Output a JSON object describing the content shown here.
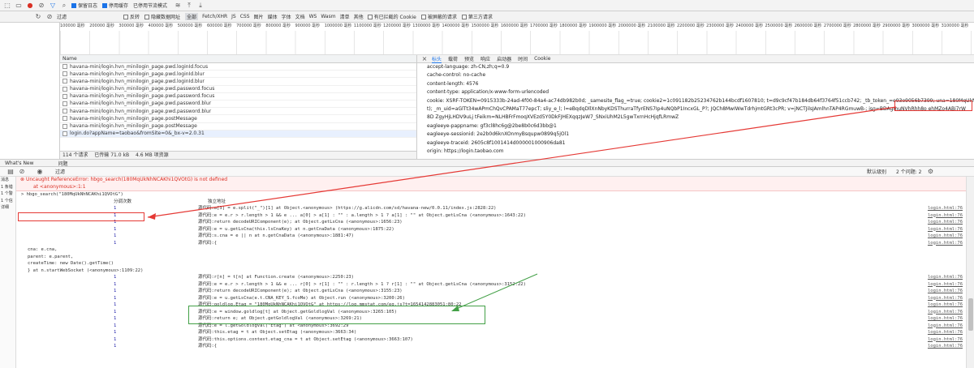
{
  "toolbar1": {
    "preserve_log": "保留日志",
    "disable_cache": "停用缓存",
    "throttle": "已停用节流模式"
  },
  "toolbar2": {
    "filter_label": "过滤",
    "invert": "反转",
    "hide_data_urls": "隐藏数据网址",
    "filters": [
      "全部",
      "Fetch/XHR",
      "JS",
      "CSS",
      "图片",
      "媒体",
      "字体",
      "文档",
      "WS",
      "Wasm",
      "清单",
      "其他"
    ],
    "blocked_cookies": "有已拦截的 Cookie",
    "blocked_requests": "被屏蔽的请求",
    "third_party": "第三方请求"
  },
  "timeline": [
    "100000 毫秒",
    "200000 毫秒",
    "300000 毫秒",
    "400000 毫秒",
    "500000 毫秒",
    "600000 毫秒",
    "700000 毫秒",
    "800000 毫秒",
    "900000 毫秒",
    "1000000 毫秒",
    "1100000 毫秒",
    "1200000 毫秒",
    "1300000 毫秒",
    "1400000 毫秒",
    "1500000 毫秒",
    "1600000 毫秒",
    "1700000 毫秒",
    "1800000 毫秒",
    "1900000 毫秒",
    "2000000 毫秒",
    "2100000 毫秒",
    "2200000 毫秒",
    "2300000 毫秒",
    "2400000 毫秒",
    "2500000 毫秒",
    "2600000 毫秒",
    "2700000 毫秒",
    "2800000 毫秒",
    "2900000 毫秒",
    "3000000 毫秒",
    "3100000 毫秒"
  ],
  "netlist": {
    "header": "Name",
    "rows": [
      "havana-mini/login.hvn_minilogin_page.pwd.loginId.focus",
      "havana-mini/login.hvn_minilogin_page.pwd.loginId.blur",
      "havana-mini/login.hvn_minilogin_page.pwd.loginId.blur",
      "havana-mini/login.hvn_minilogin_page.pwd.password.focus",
      "havana-mini/login.hvn_minilogin_page.pwd.password.focus",
      "havana-mini/login.hvn_minilogin_page.pwd.password.blur",
      "havana-mini/login.hvn_minilogin_page.pwd.password.blur",
      "havana-mini/login.hvn_minilogin_page.postMessage",
      "havana-mini/login.hvn_minilogin_page.postMessage",
      "login.do?appName=taobao&fromSite=0&_bx-v=2.0.31"
    ],
    "status": [
      "114 个请求",
      "已传输 71.0 kB",
      "4.6 MB 项资源"
    ]
  },
  "details": {
    "tabs": [
      "标头",
      "载荷",
      "预览",
      "响应",
      "启动器",
      "时间",
      "Cookie"
    ],
    "headers": [
      "accept-language: zh-CN,zh;q=0.9",
      "cache-control: no-cache",
      "content-length: 4576",
      "content-type: application/x-www-form-urlencoded",
      "cookie: XSRF-TOKEN=0915333b-24ad-4f00-84a4-ac74db982b0d; _samesite_flag_=true; cookie2=1c091182b25234762b144bcdf1607810; t=d9c9cf47b184db64f3764f51ccb742; _tb_token_=e93e9056b7399; una=180MqUkNhNCAKhi1QVOtG",
      "t); _m_uid=aGlTt34wAPmChQvCPAMaT77epcT; sliy_e_l; l=eBqdqDllXnNbyKDSThurraTfyrENS7Ip4uNQbP1IncxGL_P?; JQCh8MwIWwTdrhjmtGRt3cPR; v=jNCTJilsJAmlhnTAP4RGmuwB-; isg=BDAgmuNVhRhh8o ehMZo4ABi7rW",
      "8D ZgyHjLHDV9uLj tFeikm=NLHBFrFmoqXVEzd5Y0DkFJHEXqqzJeW7_SNxiUhM2L5gwTxrnHcHjqfLRmwZ",
      "eagleeye-pappname: gf3cl8hc6g@2be8b0c6d3bb@1",
      "eagleeye-sessionid: 2e2b0d6knXOnmyBsqupw0899q5jOl1",
      "eagleeye-traceid: 2605c8f1001414d000001000906da81",
      "origin: https://login.taobao.com"
    ]
  },
  "drawer": {
    "tabs": [
      "What's New",
      "问题"
    ]
  },
  "console_toolbar": {
    "filter": "过滤",
    "levels": "默认级别",
    "issues": "2 个问题: 2"
  },
  "sidebar": [
    "消息",
    "1 条错误",
    "1 个警告",
    "1 个信息",
    "详细"
  ],
  "console": {
    "error_line1": "Uncaught ReferenceError: hbgo_search(180MqUkNhNCAKhi1QVOtG) is not defined",
    "error_line2": "at <anonymous>:1:1",
    "input_line": "> hbgo_search(\"180MqUkNhNCAKhi1QVOtG\")",
    "col_count": "分调次数",
    "col_trace": "独立地址",
    "rows": [
      {
        "num": "1",
        "txt": "源代码:a[3] = e.split(\"_\")[1]   at Object.<anonymous> (https://g.alicdn.com/sd/havana-new/0.0.11/index.js:2828:22)",
        "src": "login.html:76"
      },
      {
        "num": "1",
        "txt": "源代码:e = e.r > r.length > 1 && e ... a[0] > a[1] : \"\" : a.length > 1 ? a[1] : \"\"   at Object.getLsCna (<anonymous>:1643:22)",
        "src": "login.html:76"
      },
      {
        "num": "1",
        "txt": "源代码:return decodeURIComponent(e);   at Object.getLsCna (<anonymous>:1656:23)",
        "src": "login.html:76"
      },
      {
        "num": "1",
        "txt": "源代码:e = u.getLsCna(this.lsCnaKey)   at n.getCnaData (<anonymous>:1875:22)",
        "src": "login.html:76"
      },
      {
        "num": "1",
        "txt": "源代码:s.cna = e || n   at n.getCnaData (<anonymous>:1881:47)",
        "src": "login.html:76"
      },
      {
        "num": "1",
        "txt": "源代码:{",
        "src": "login.html:76"
      },
      {
        "plain": "cna: e.cna,"
      },
      {
        "plain": "parent: e.parent,"
      },
      {
        "plain": "createTime: new Date().getTime()"
      },
      {
        "plain": "}     at n.startWebSocket (<anonymous>:1109:22)"
      },
      {
        "num": "1",
        "txt": "源代码:r[n] = t[n]   at Function.create (<anonymous>:2250:23)",
        "src": "login.html:76"
      },
      {
        "num": "1",
        "txt": "源代码:e = e.r > r.length > 1 && e ... r[0] > r[1] : \"\" : r.length > 1 ? r[1] : \"\"   at Object.getLsCna (<anonymous>:3152:22)",
        "src": "login.html:76"
      },
      {
        "num": "1",
        "txt": "源代码:return decodeURIComponent(e);   at Object.getLsCna (<anonymous>:3155:23)",
        "src": "login.html:76"
      },
      {
        "num": "1",
        "txt": "源代码:e = u.getLsCna(e.t.CNA_KEY_S.fcoMe)   at Object.run (<anonymous>:3200:26)",
        "src": "login.html:76"
      },
      {
        "num": "1",
        "txt": "源代码:goldlog.Etag = \"180MqUkNhNCAKhi1QVOtG\"   at https://log.mmstat.com/eg.js?t=1654142883051:80:22",
        "src": "login.html:76"
      },
      {
        "num": "1",
        "txt": "源代码:e = window.goldlog[t]   at Object.getGoldlogVal (<anonymous>:3265:105)",
        "src": "login.html:76"
      },
      {
        "num": "1",
        "txt": "源代码:return e;   at Object.getGoldlogVal (<anonymous>:3269:21)",
        "src": "login.html:76"
      },
      {
        "num": "1",
        "txt": "源代码:e = l.getGoldlogVal(\"Etag\")   at <anonymous>:3692:29",
        "src": "login.html:76"
      },
      {
        "num": "1",
        "txt": "源代码:this.etag = t   at Object.setEtag (<anonymous>:3663:34)",
        "src": "login.html:76"
      },
      {
        "num": "1",
        "txt": "源代码:this.options.context.etag_cna = t   at Object.setEtag (<anonymous>:3663:107)",
        "src": "login.html:76"
      },
      {
        "num": "1",
        "txt": "源代码:{",
        "src": "login.html:76"
      }
    ]
  },
  "colors": {
    "error_red": "#d93025",
    "annotation_red": "#e53935",
    "annotation_green": "#43a047",
    "selected_blue": "#1a73e8"
  }
}
